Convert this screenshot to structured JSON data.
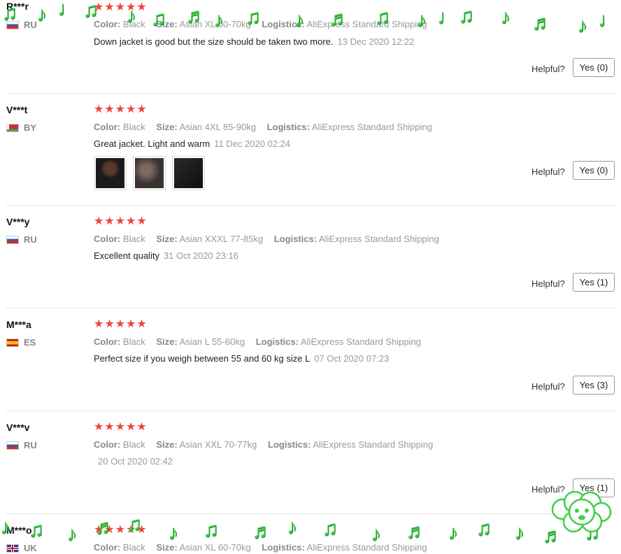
{
  "reviews": [
    {
      "user": "R***r",
      "country": "RU",
      "flag": "ru",
      "meta": {
        "color_label": "Color:",
        "color": "Black",
        "size_label": "Size:",
        "size": "Asian XL 60-70kg",
        "logistics_label": "Logistics:",
        "logistics": "AliExpress Standard Shipping"
      },
      "text": "Down jacket is good but the size should be taken two more.",
      "date": "13 Dec 2020 12:22",
      "helpful_label": "Helpful?",
      "yes_label": "Yes (0)",
      "stars": "★★★★★"
    },
    {
      "user": "V***t",
      "country": "BY",
      "flag": "by",
      "meta": {
        "color_label": "Color:",
        "color": "Black",
        "size_label": "Size:",
        "size": "Asian 4XL 85-90kg",
        "logistics_label": "Logistics:",
        "logistics": "AliExpress Standard Shipping"
      },
      "text": "Great jacket. Light and warm",
      "date": "11 Dec 2020 02:24",
      "helpful_label": "Helpful?",
      "yes_label": "Yes (0)",
      "stars": "★★★★★"
    },
    {
      "user": "V***y",
      "country": "RU",
      "flag": "ru",
      "meta": {
        "color_label": "Color:",
        "color": "Black",
        "size_label": "Size:",
        "size": "Asian XXXL 77-85kg",
        "logistics_label": "Logistics:",
        "logistics": "AliExpress Standard Shipping"
      },
      "text": "Excellent quality",
      "date": "31 Oct 2020 23:16",
      "helpful_label": "Helpful?",
      "yes_label": "Yes (1)",
      "stars": "★★★★★"
    },
    {
      "user": "M***a",
      "country": "ES",
      "flag": "es",
      "meta": {
        "color_label": "Color:",
        "color": "Black",
        "size_label": "Size:",
        "size": "Asian L 55-60kg",
        "logistics_label": "Logistics:",
        "logistics": "AliExpress Standard Shipping"
      },
      "text": "Perfect size if you weigh between 55 and 60 kg size L",
      "date": "07 Oct 2020 07:23",
      "helpful_label": "Helpful?",
      "yes_label": "Yes (3)",
      "stars": "★★★★★"
    },
    {
      "user": "V***v",
      "country": "RU",
      "flag": "ru",
      "meta": {
        "color_label": "Color:",
        "color": "Black",
        "size_label": "Size:",
        "size": "Asian XXL 70-77kg",
        "logistics_label": "Logistics:",
        "logistics": "AliExpress Standard Shipping"
      },
      "text": "",
      "date": "20 Oct 2020 02:42",
      "helpful_label": "Helpful?",
      "yes_label": "Yes (1)",
      "stars": "★★★★★"
    },
    {
      "user": "M***o",
      "country": "UK",
      "flag": "uk",
      "meta": {
        "color_label": "Color:",
        "color": "Black",
        "size_label": "Size:",
        "size": "Asian XL 60-70kg",
        "logistics_label": "Logistics:",
        "logistics": "AliExpress Standard Shipping"
      },
      "stars": "★★★★★"
    }
  ],
  "rating": 5,
  "colors": {
    "star": "#f44336",
    "note": "#3fd04a"
  },
  "decorations": {
    "icon": "music-note-icon",
    "mascot": "poodle-doodle-icon"
  }
}
